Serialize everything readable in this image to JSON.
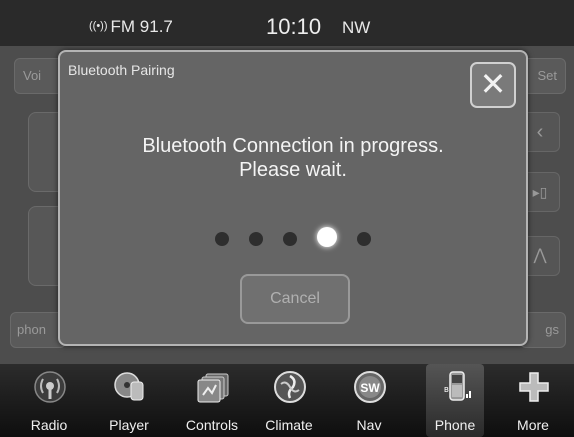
{
  "status": {
    "radio": "FM 91.7",
    "time": "10:10",
    "direction": "NW"
  },
  "background": {
    "top_left_btn": "Voi",
    "top_right_btn": "Set",
    "bottom_left_btn": "phon",
    "bottom_right_btn": "gs"
  },
  "modal": {
    "title": "Bluetooth Pairing",
    "message_line1": "Bluetooth Connection in progress.",
    "message_line2": "Please wait.",
    "progress": {
      "total_dots": 5,
      "active_dot": 4
    },
    "cancel_label": "Cancel",
    "close_symbol": "✕"
  },
  "dock": {
    "items": [
      {
        "label": "Radio",
        "icon": "radio-icon"
      },
      {
        "label": "Player",
        "icon": "player-icon"
      },
      {
        "label": "Controls",
        "icon": "controls-icon"
      },
      {
        "label": "Climate",
        "icon": "climate-icon"
      },
      {
        "label": "Nav",
        "icon": "nav-icon"
      },
      {
        "label": "Phone",
        "icon": "phone-icon"
      },
      {
        "label": "More",
        "icon": "more-icon"
      }
    ],
    "active_item": "Phone"
  }
}
